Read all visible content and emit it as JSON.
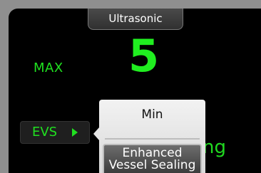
{
  "header": {
    "title": "Ultrasonic"
  },
  "power": {
    "label": "MAX",
    "value": "5"
  },
  "background_partial": {
    "char_1": "l",
    "char_2": "ng"
  },
  "mode_button": {
    "label": "EVS"
  },
  "mode_menu": {
    "options": [
      "Min",
      "Enhanced Vessel Sealing"
    ],
    "selected_line1": "Enhanced",
    "selected_line2": "Vessel Sealing"
  },
  "colors": {
    "accent_green": "#20e020",
    "panel": "#000000",
    "menu": "#e6e6e6"
  },
  "icons": {
    "evs_arrow": "triangle-right-icon",
    "popup_pointer": "triangle-left-icon"
  }
}
